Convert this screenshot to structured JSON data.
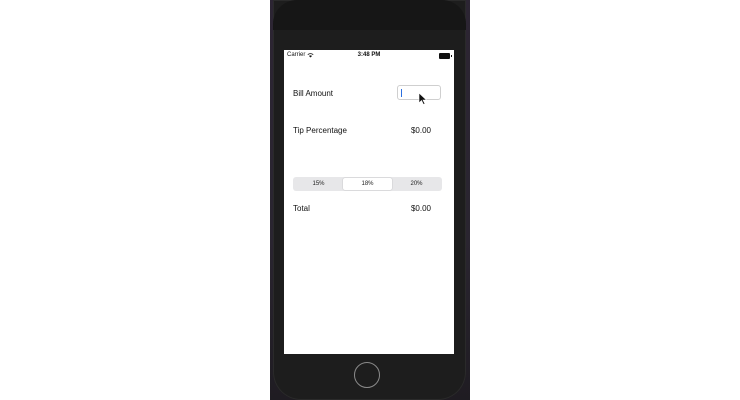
{
  "status_bar": {
    "carrier": "Carrier",
    "time": "3:48 PM",
    "wifi_icon": "wifi-icon",
    "battery_icon": "battery-icon"
  },
  "bill": {
    "label": "Bill Amount",
    "input_value": "",
    "placeholder": ""
  },
  "tip": {
    "label": "Tip Percentage",
    "value": "$0.00"
  },
  "segmented_control": {
    "options": [
      "15%",
      "18%",
      "20%"
    ],
    "selected": "18%"
  },
  "total": {
    "label": "Total",
    "value": "$0.00"
  },
  "colors": {
    "screen_background": "#ffffff",
    "caret": "#2b6fe0",
    "segment_background": "#e7e7e9"
  }
}
